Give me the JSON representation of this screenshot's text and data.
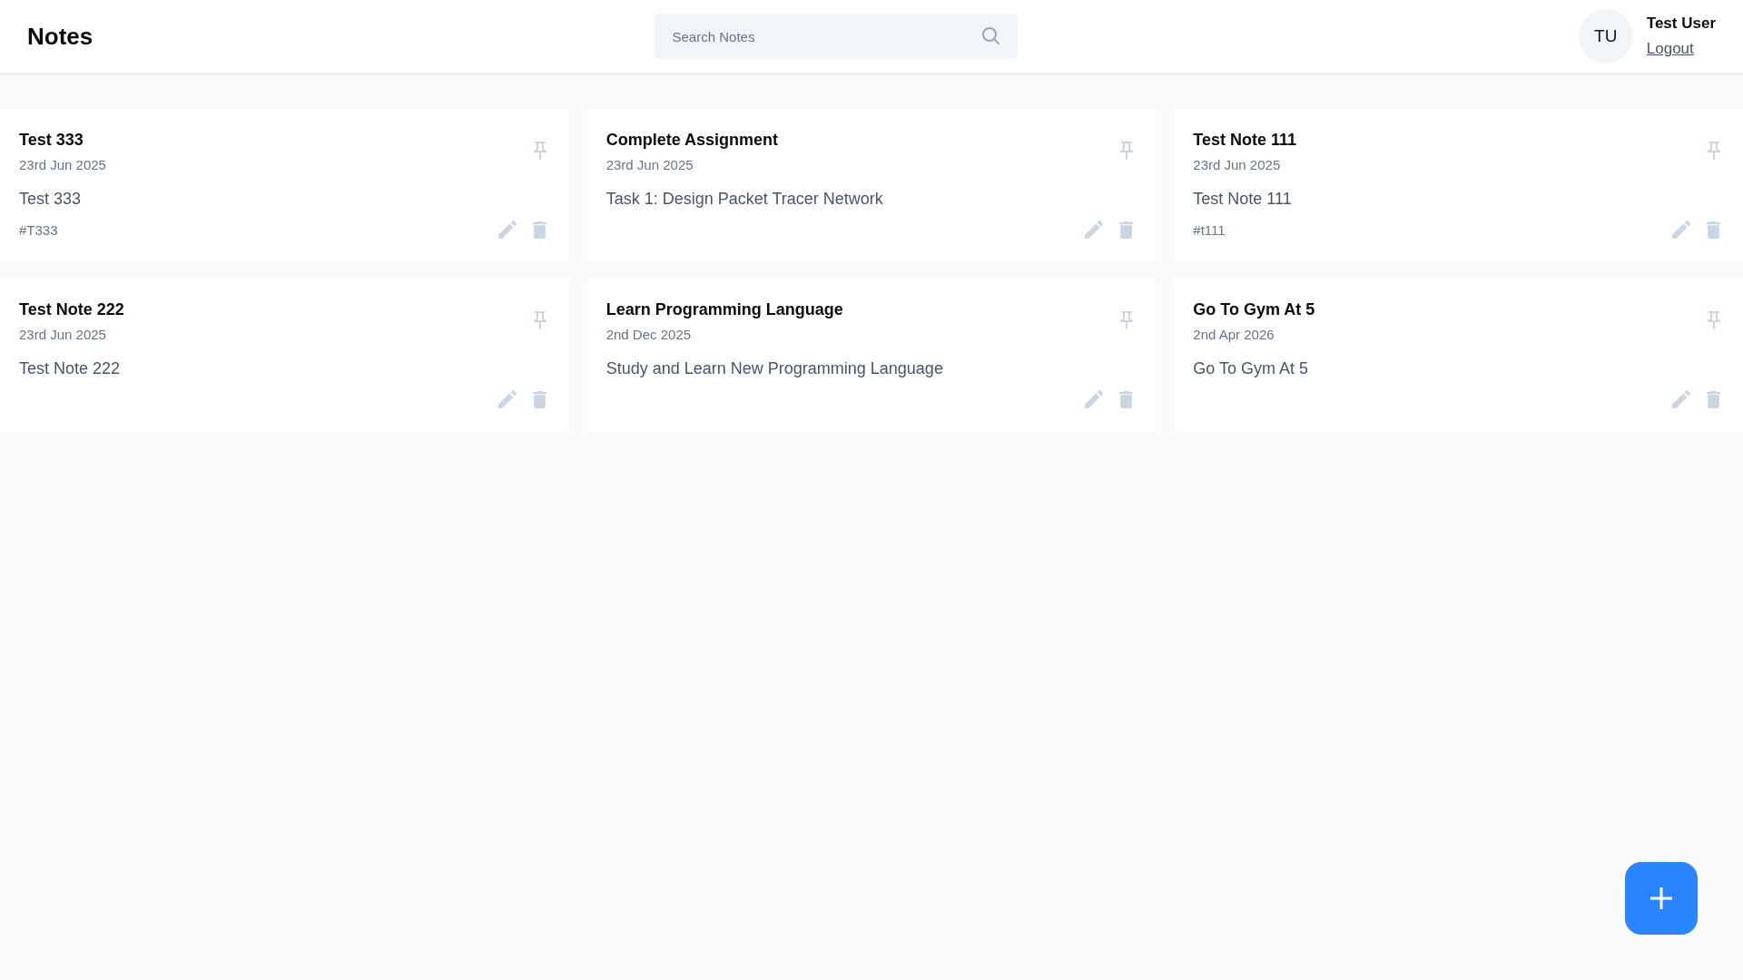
{
  "header": {
    "title": "Notes",
    "search": {
      "placeholder": "Search Notes"
    },
    "user": {
      "initials": "TU",
      "name": "Test User",
      "logout": "Logout"
    }
  },
  "notes": [
    {
      "title": "Test 333",
      "date": "23rd Jun 2025",
      "content": "Test 333",
      "tags": [
        "#T333"
      ],
      "pinned": false
    },
    {
      "title": "Complete Assignment",
      "date": "23rd Jun 2025",
      "content": "Task 1: Design Packet Tracer Network",
      "pinned": false
    },
    {
      "title": "Test Note 111",
      "date": "23rd Jun 2025",
      "content": "Test Note 111",
      "tags": [
        "#t111"
      ],
      "pinned": false
    },
    {
      "title": "Test Note 222",
      "date": "23rd Jun 2025",
      "content": "Test Note 222",
      "pinned": false
    },
    {
      "title": "Learn Programming Language",
      "date": "2nd Dec 2025",
      "content": "Study and Learn New Programming Language",
      "pinned": false
    },
    {
      "title": "Go To Gym At 5",
      "date": "2nd Apr 2026",
      "content": "Go To Gym At 5",
      "pinned": false
    }
  ]
}
